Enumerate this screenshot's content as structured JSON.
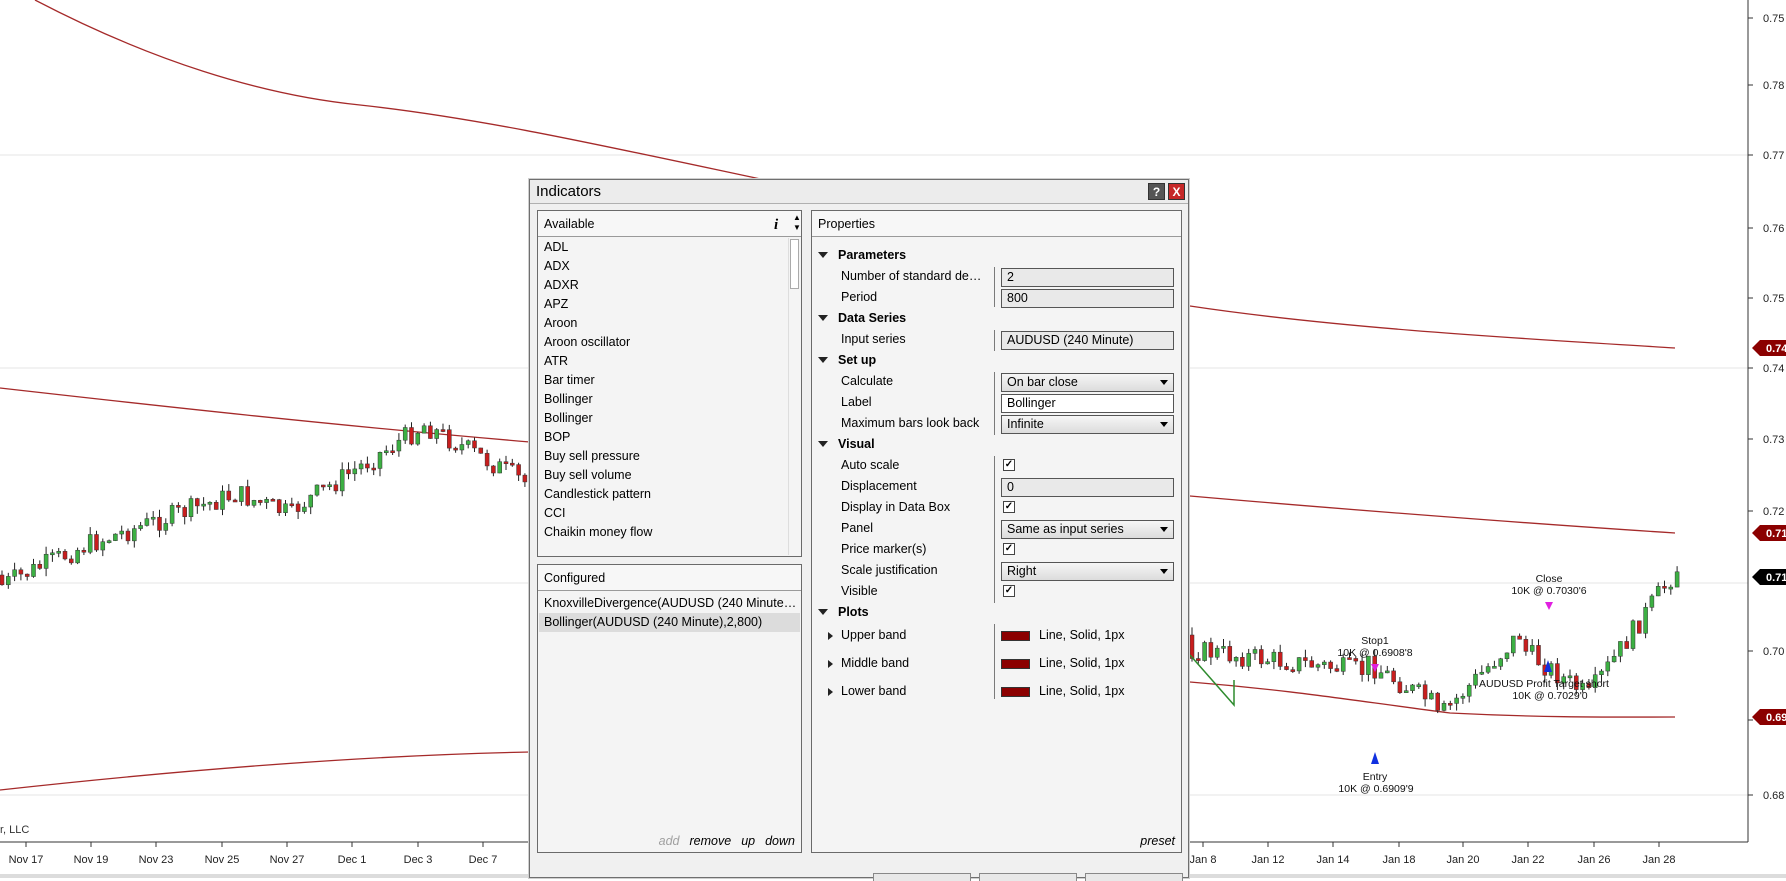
{
  "chart": {
    "x_labels": [
      "Nov 17",
      "Nov 19",
      "Nov 23",
      "Nov 25",
      "Nov 27",
      "Dec 1",
      "Dec 3",
      "Dec 7",
      "Jan 8",
      "Jan 12",
      "Jan 14",
      "Jan 18",
      "Jan 20",
      "Jan 22",
      "Jan 26",
      "Jan 28"
    ],
    "y_labels": [
      "0.75",
      "0.78",
      "0.77",
      "0.76",
      "0.75",
      "0.74",
      "0.73",
      "0.72",
      "0.70",
      "0.69",
      "0.68"
    ],
    "price_markers": [
      "0.74",
      "0.71",
      "0.71",
      "0.69"
    ],
    "copyright": "r, LLC",
    "annotations": {
      "close_title": "Close",
      "close_detail": "10K @ 0.7030'6",
      "stop_title": "Stop1",
      "stop_detail": "10K @ 0.6908'8",
      "target_title": "AUDUSD Profit Target short",
      "target_detail": "10K @ 0.7029'0",
      "entry_title": "Entry",
      "entry_detail": "10K @ 0.6909'9"
    },
    "colors": {
      "band": "#a52a2a",
      "up_candle": "#3cb043",
      "down_candle": "#c81e1e",
      "marker": "#8b0000"
    }
  },
  "dialog": {
    "title": "Indicators",
    "help_label": "?",
    "close_label": "X",
    "available": {
      "header": "Available",
      "info_label": "i",
      "items": [
        "ADL",
        "ADX",
        "ADXR",
        "APZ",
        "Aroon",
        "Aroon oscillator",
        "ATR",
        "Bar timer",
        "Bollinger",
        "Bollinger",
        "BOP",
        "Buy sell pressure",
        "Buy sell volume",
        "Candlestick pattern",
        "CCI",
        "Chaikin money flow"
      ]
    },
    "configured": {
      "header": "Configured",
      "items": [
        "KnoxvilleDivergence(AUDUSD (240 Minute),...",
        "Bollinger(AUDUSD (240 Minute),2,800)"
      ],
      "actions": {
        "add": "add",
        "remove": "remove",
        "up": "up",
        "down": "down"
      }
    },
    "properties": {
      "header": "Properties",
      "sections": {
        "parameters": "Parameters",
        "data_series": "Data Series",
        "setup": "Set up",
        "visual": "Visual",
        "plots": "Plots"
      },
      "rows": {
        "std_dev_label": "Number of standard devi...",
        "std_dev_value": "2",
        "period_label": "Period",
        "period_value": "800",
        "input_series_label": "Input series",
        "input_series_value": "AUDUSD (240 Minute)",
        "calculate_label": "Calculate",
        "calculate_value": "On bar close",
        "label_label": "Label",
        "label_value": "Bollinger",
        "max_bars_label": "Maximum bars look back",
        "max_bars_value": "Infinite",
        "auto_scale_label": "Auto scale",
        "displacement_label": "Displacement",
        "displacement_value": "0",
        "data_box_label": "Display in Data Box",
        "panel_label": "Panel",
        "panel_value": "Same as input series",
        "price_marker_label": "Price marker(s)",
        "scale_just_label": "Scale justification",
        "scale_just_value": "Right",
        "visible_label": "Visible",
        "upper_band_label": "Upper band",
        "upper_band_value": "Line, Solid, 1px",
        "middle_band_label": "Middle band",
        "middle_band_value": "Line, Solid, 1px",
        "lower_band_label": "Lower band",
        "lower_band_value": "Line, Solid, 1px"
      },
      "preset_label": "preset"
    }
  }
}
